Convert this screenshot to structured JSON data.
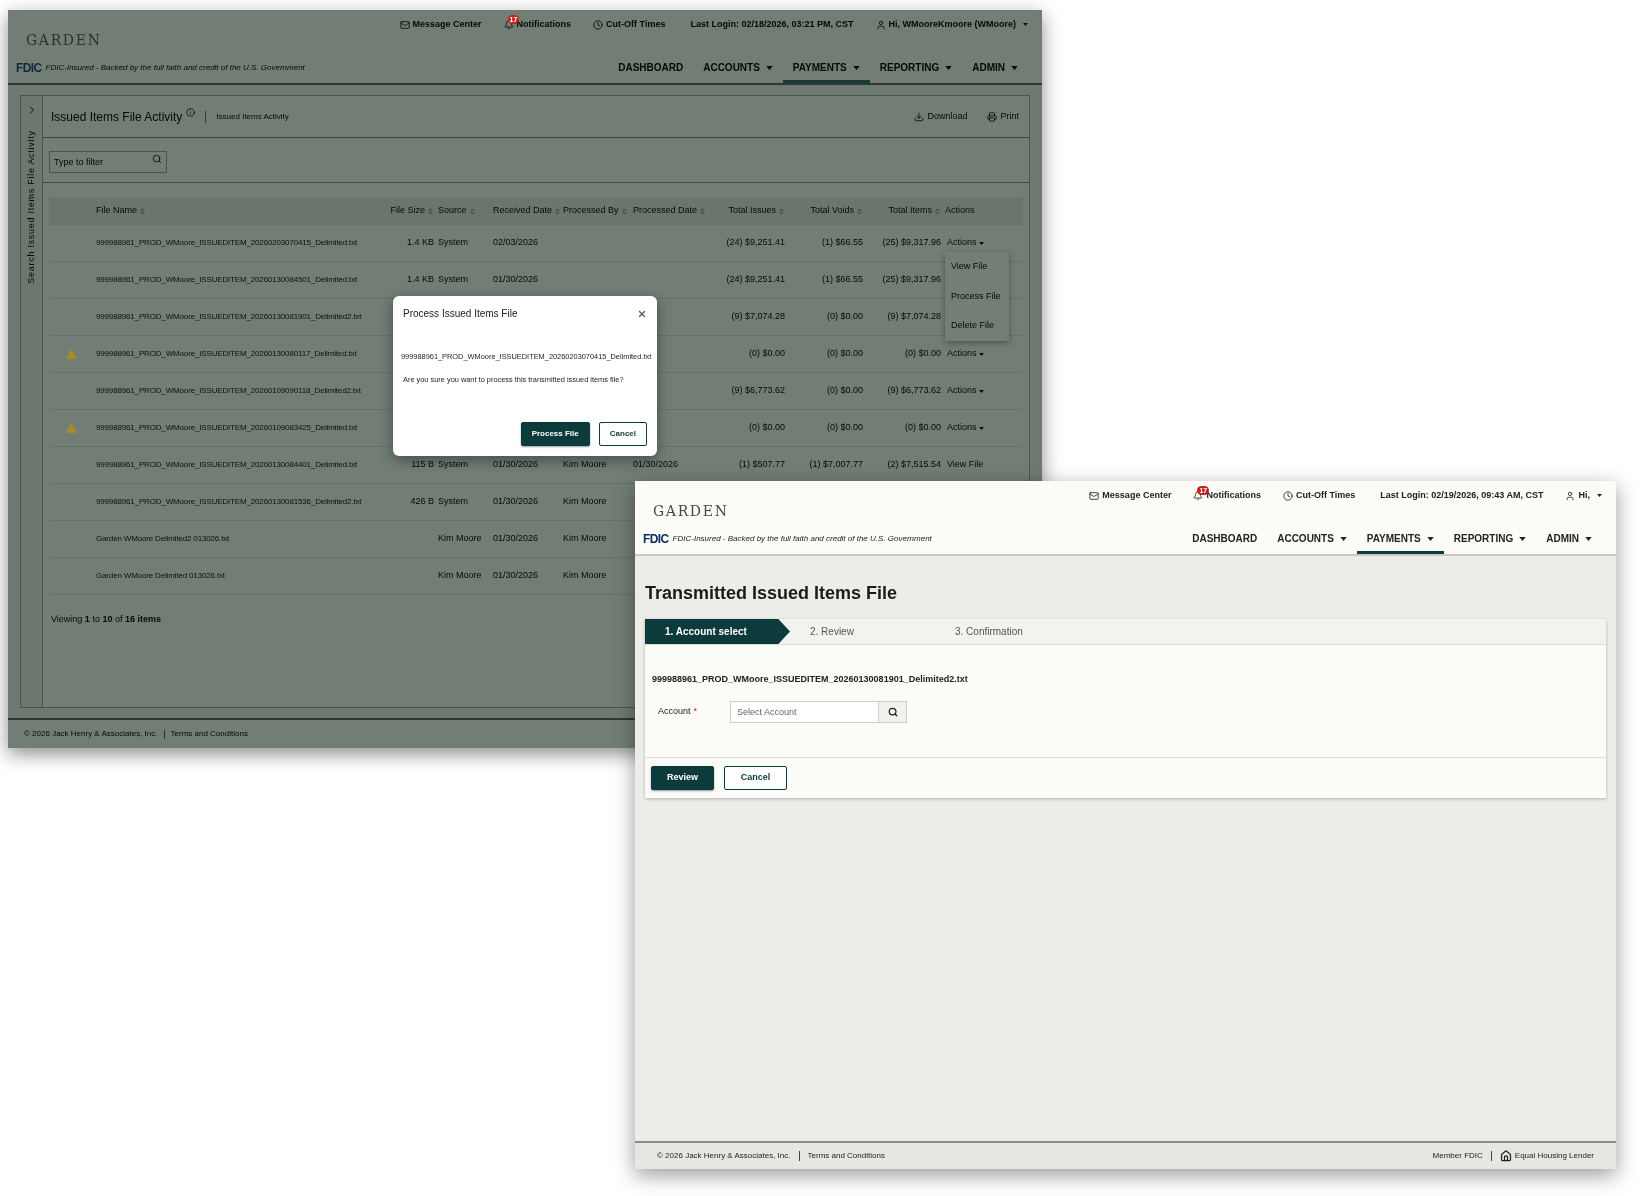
{
  "back_window": {
    "header": {
      "logo": "GARDEN",
      "utility": [
        {
          "kind": "messages",
          "label": "Message Center"
        },
        {
          "kind": "notifications",
          "label": "Notifications",
          "badge": "17"
        },
        {
          "kind": "clock",
          "label": "Cut-Off Times"
        },
        {
          "kind": "text",
          "label": "Last Login: 02/18/2026, 03:21 PM, CST"
        },
        {
          "kind": "user",
          "label": "Hi, WMooreKmoore (WMoore)"
        }
      ],
      "fdic_mark": "FDIC",
      "fdic_text": "FDIC-Insured - Backed by the full faith and credit of the U.S. Government",
      "nav": [
        {
          "label": "DASHBOARD",
          "dropdown": false,
          "selected": false
        },
        {
          "label": "ACCOUNTS",
          "dropdown": true,
          "selected": false
        },
        {
          "label": "PAYMENTS",
          "dropdown": true,
          "selected": true
        },
        {
          "label": "REPORTING",
          "dropdown": true,
          "selected": false
        },
        {
          "label": "ADMIN",
          "dropdown": true,
          "selected": false
        }
      ]
    },
    "sidebar_label": "Search Issued Items File Activity",
    "page_title": "Issued Items File Activity",
    "breadcrumb": "Issued Items Activity",
    "toolbar": [
      {
        "kind": "download",
        "label": "Download"
      },
      {
        "kind": "print",
        "label": "Print"
      }
    ],
    "filter": {
      "placeholder": "Type to filter"
    },
    "table": {
      "columns": [
        {
          "label": "File Name",
          "sortable": true
        },
        {
          "label": "File Size",
          "sortable": true
        },
        {
          "label": "Source",
          "sortable": true
        },
        {
          "label": "Received Date",
          "sortable": true
        },
        {
          "label": "Processed By",
          "sortable": true
        },
        {
          "label": "Processed Date",
          "sortable": true
        },
        {
          "label": "Total Issues",
          "sortable": true
        },
        {
          "label": "Total Voids",
          "sortable": true
        },
        {
          "label": "Total Items",
          "sortable": true
        },
        {
          "label": "Actions",
          "sortable": false
        }
      ],
      "rows": [
        {
          "warning": false,
          "file_name": "999988961_PROD_WMoore_ISSUEDITEM_20260203070415_Delimited.txt",
          "file_size": "1.4 KB",
          "source": "System",
          "received_date": "02/03/2026",
          "total_issues": "(24) $9,251.41",
          "total_voids": "(1) $66.55",
          "total_items": "(25) $9,317.96",
          "action": {
            "kind": "menu",
            "label": "Actions",
            "menu": [
              "View File",
              "Process File",
              "Delete File"
            ]
          }
        },
        {
          "warning": false,
          "file_name": "999988961_PROD_WMoore_ISSUEDITEM_20260130084501_Delimited.txt",
          "file_size": "1.4 KB",
          "source": "System",
          "received_date": "01/30/2026",
          "total_issues": "(24) $9,251.41",
          "total_voids": "(1) $66.55",
          "total_items": "(25) $9,317.96"
        },
        {
          "warning": false,
          "file_name": "999988961_PROD_WMoore_ISSUEDITEM_20260130081901_Delimited2.txt",
          "total_issues": "(9) $7,074.28",
          "total_voids": "(0) $0.00",
          "total_items": "(9) $7,074.28"
        },
        {
          "warning": true,
          "file_name": "999988961_PROD_WMoore_ISSUEDITEM_20260130080117_Delimited.txt",
          "total_issues": "(0) $0.00",
          "total_voids": "(0) $0.00",
          "total_items": "(0) $0.00",
          "action": {
            "kind": "menu",
            "label": "Actions"
          }
        },
        {
          "warning": false,
          "file_name": "999988961_PROD_WMoore_ISSUEDITEM_20260109090118_Delimited2.txt",
          "total_issues": "(9) $6,773.62",
          "total_voids": "(0) $0.00",
          "total_items": "(9) $6,773.62",
          "action": {
            "kind": "menu",
            "label": "Actions"
          }
        },
        {
          "warning": true,
          "file_name": "999988961_PROD_WMoore_ISSUEDITEM_20260109083425_Delimited.txt",
          "total_issues": "(0) $0.00",
          "total_voids": "(0) $0.00",
          "total_items": "(0) $0.00",
          "action": {
            "kind": "menu",
            "label": "Actions"
          }
        },
        {
          "warning": false,
          "file_name": "999988961_PROD_WMoore_ISSUEDITEM_20260130084401_Delimited.txt",
          "file_size": "115 B",
          "source": "System",
          "received_date": "01/30/2026",
          "processed_by": "Kim Moore",
          "processed_date": "01/30/2026",
          "total_issues": "(1) $507.77",
          "total_voids": "(1) $7,007.77",
          "total_items": "(2) $7,515.54",
          "action": {
            "kind": "link",
            "label": "View File"
          }
        },
        {
          "warning": false,
          "file_name": "999988961_PROD_WMoore_ISSUEDITEM_20260130081536_Delimited2.txt",
          "file_size": "426 B",
          "source": "System",
          "received_date": "01/30/2026",
          "processed_by": "Kim Moore"
        },
        {
          "warning": false,
          "file_name": "Garden WMoore Delimited2 013026.txt",
          "source": "Kim Moore",
          "received_date": "01/30/2026",
          "processed_by": "Kim Moore"
        },
        {
          "warning": false,
          "file_name": "Garden WMoore Delimited 013026.txt",
          "source": "Kim Moore",
          "received_date": "01/30/2026",
          "processed_by": "Kim Moore"
        }
      ]
    },
    "pager": "Viewing **1** to **10** of **16 items**",
    "footer": {
      "copyright": "© 2026 Jack Henry & Associates, Inc.",
      "link": "Terms and Conditions"
    }
  },
  "dialog": {
    "title": "Process Issued Items File",
    "file_name": "999988961_PROD_WMoore_ISSUEDITEM_20260203070415_Delimited.txt",
    "message": "Are you sure you want to process this transmitted issued items file?",
    "buttons": [
      {
        "kind": "primary",
        "label": "Process File"
      },
      {
        "kind": "secondary",
        "label": "Cancel"
      }
    ]
  },
  "front_window": {
    "header": {
      "logo": "GARDEN",
      "utility": [
        {
          "kind": "messages",
          "label": "Message Center"
        },
        {
          "kind": "notifications",
          "label": "Notifications",
          "badge": "17"
        },
        {
          "kind": "clock",
          "label": "Cut-Off Times"
        },
        {
          "kind": "text",
          "label": "Last Login: 02/19/2026, 09:43 AM, CST"
        },
        {
          "kind": "user",
          "label": "Hi,"
        }
      ],
      "fdic_mark": "FDIC",
      "fdic_text": "FDIC-Insured - Backed by the full faith and credit of the U.S. Government",
      "nav": [
        {
          "label": "DASHBOARD",
          "dropdown": false,
          "selected": false
        },
        {
          "label": "ACCOUNTS",
          "dropdown": true,
          "selected": false
        },
        {
          "label": "PAYMENTS",
          "dropdown": true,
          "selected": true
        },
        {
          "label": "REPORTING",
          "dropdown": true,
          "selected": false
        },
        {
          "label": "ADMIN",
          "dropdown": true,
          "selected": false
        }
      ]
    },
    "page_title": "Transmitted Issued Items File",
    "steps": [
      {
        "label": "1. Account select",
        "selected": true
      },
      {
        "label": "2. Review",
        "selected": false
      },
      {
        "label": "3. Confirmation",
        "selected": false
      }
    ],
    "file_name": "999988961_PROD_WMoore_ISSUEDITEM_20260130081901_Delimited2.txt",
    "account": {
      "label": "Account",
      "required_mark": "*",
      "placeholder": "Select Account"
    },
    "buttons": [
      {
        "kind": "primary",
        "label": "Review"
      },
      {
        "kind": "secondary",
        "label": "Cancel"
      }
    ],
    "footer": {
      "copyright": "© 2026 Jack Henry & Associates, Inc.",
      "link": "Terms and Conditions",
      "member": "Member FDIC",
      "housing": "Equal Housing Lender"
    }
  }
}
